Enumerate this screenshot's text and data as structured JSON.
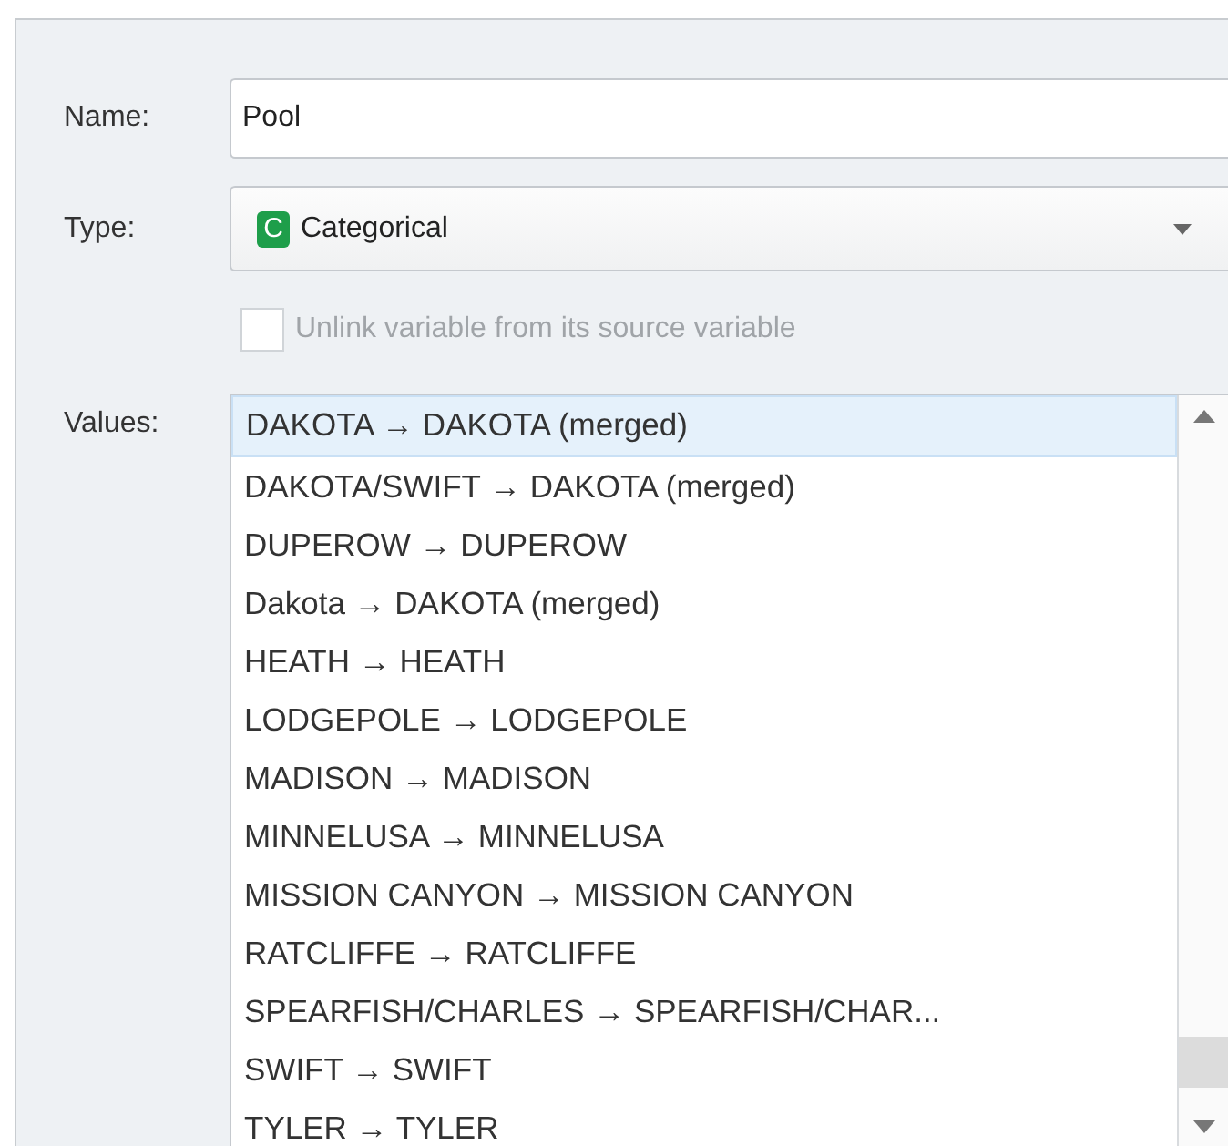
{
  "fields": [
    {
      "kind": "text",
      "label": "Name:",
      "value": "Pool"
    },
    {
      "kind": "dropdown",
      "label": "Type:",
      "badge": "C",
      "value": "Categorical"
    }
  ],
  "unlink": {
    "label": "Unlink variable from its source variable",
    "checked": false,
    "disabled": true
  },
  "values": {
    "label": "Values:",
    "items": [
      {
        "text": "DAKOTA → DAKOTA (merged)",
        "selected": true
      },
      {
        "text": "DAKOTA/SWIFT → DAKOTA (merged)",
        "selected": false
      },
      {
        "text": "DUPEROW → DUPEROW",
        "selected": false
      },
      {
        "text": "Dakota → DAKOTA (merged)",
        "selected": false
      },
      {
        "text": "HEATH → HEATH",
        "selected": false
      },
      {
        "text": "LODGEPOLE → LODGEPOLE",
        "selected": false
      },
      {
        "text": "MADISON → MADISON",
        "selected": false
      },
      {
        "text": "MINNELUSA → MINNELUSA",
        "selected": false
      },
      {
        "text": "MISSION CANYON → MISSION CANYON",
        "selected": false
      },
      {
        "text": "RATCLIFFE → RATCLIFFE",
        "selected": false
      },
      {
        "text": "SPEARFISH/CHARLES → SPEARFISH/CHAR...",
        "selected": false
      },
      {
        "text": "SWIFT → SWIFT",
        "selected": false
      },
      {
        "text": "TYLER → TYLER",
        "selected": false
      }
    ]
  }
}
